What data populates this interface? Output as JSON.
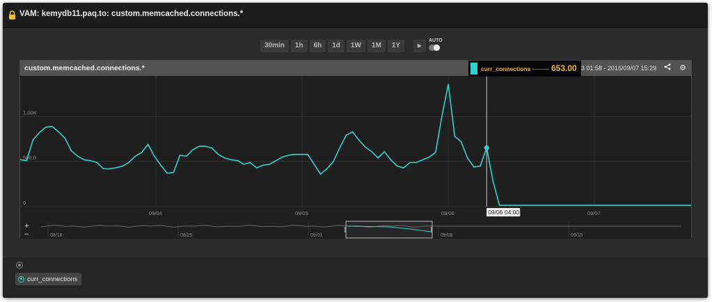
{
  "window": {
    "title": "VAM: kemydb11.paq.to: custom.memcached.connections.*"
  },
  "range_buttons": [
    "30min",
    "1h",
    "6h",
    "1d",
    "1W",
    "1M",
    "1Y"
  ],
  "controls": {
    "play_icon": "play-icon",
    "auto_label": "AUTO",
    "auto_on": false
  },
  "panel": {
    "title": "custom.memcached.connections.*",
    "date_range_visible": "01:58 - 2016/09/07 15:29",
    "date_range_prefix": "3",
    "share_icon": "share-icon",
    "settings_icon": "gear-icon"
  },
  "hover": {
    "series": "curr_connections",
    "value": "653.00",
    "time_label": "09/06 04:00",
    "color": "#2ed3d0"
  },
  "colors": {
    "series": "#2ed3d0",
    "accent": "#f2b62c"
  },
  "chart_data": {
    "type": "line",
    "title": "custom.memcached.connections.*",
    "x_ticks": [
      "09/04",
      "09/05",
      "09/06",
      "09/07"
    ],
    "y_ticks": [
      "0",
      "500.0",
      "1.00K"
    ],
    "ylim": [
      0,
      1450
    ],
    "grid": true,
    "series": [
      {
        "name": "curr_connections",
        "values": [
          520,
          510,
          740,
          820,
          880,
          890,
          830,
          760,
          620,
          560,
          520,
          510,
          490,
          420,
          420,
          430,
          450,
          490,
          560,
          600,
          690,
          560,
          460,
          370,
          380,
          570,
          560,
          630,
          670,
          670,
          650,
          580,
          540,
          520,
          510,
          470,
          490,
          430,
          460,
          470,
          510,
          550,
          570,
          580,
          580,
          580,
          470,
          360,
          420,
          500,
          650,
          790,
          830,
          740,
          660,
          610,
          540,
          610,
          520,
          450,
          430,
          490,
          490,
          520,
          550,
          600,
          1000,
          1360,
          780,
          720,
          540,
          440,
          450,
          653,
          280,
          15,
          15,
          15,
          15,
          15,
          15,
          15,
          15,
          15,
          15,
          15,
          15,
          15,
          15,
          15,
          15,
          15,
          15,
          15,
          15,
          15,
          15,
          15,
          15,
          15,
          15,
          15,
          15,
          15,
          15,
          15
        ]
      }
    ]
  },
  "navigator": {
    "ticks": [
      "08/18",
      "08/25",
      "09/01",
      "09/08",
      "09/15"
    ],
    "zoom_in": "+",
    "zoom_out": "−"
  },
  "legend": {
    "series": [
      "curr_connections"
    ]
  }
}
